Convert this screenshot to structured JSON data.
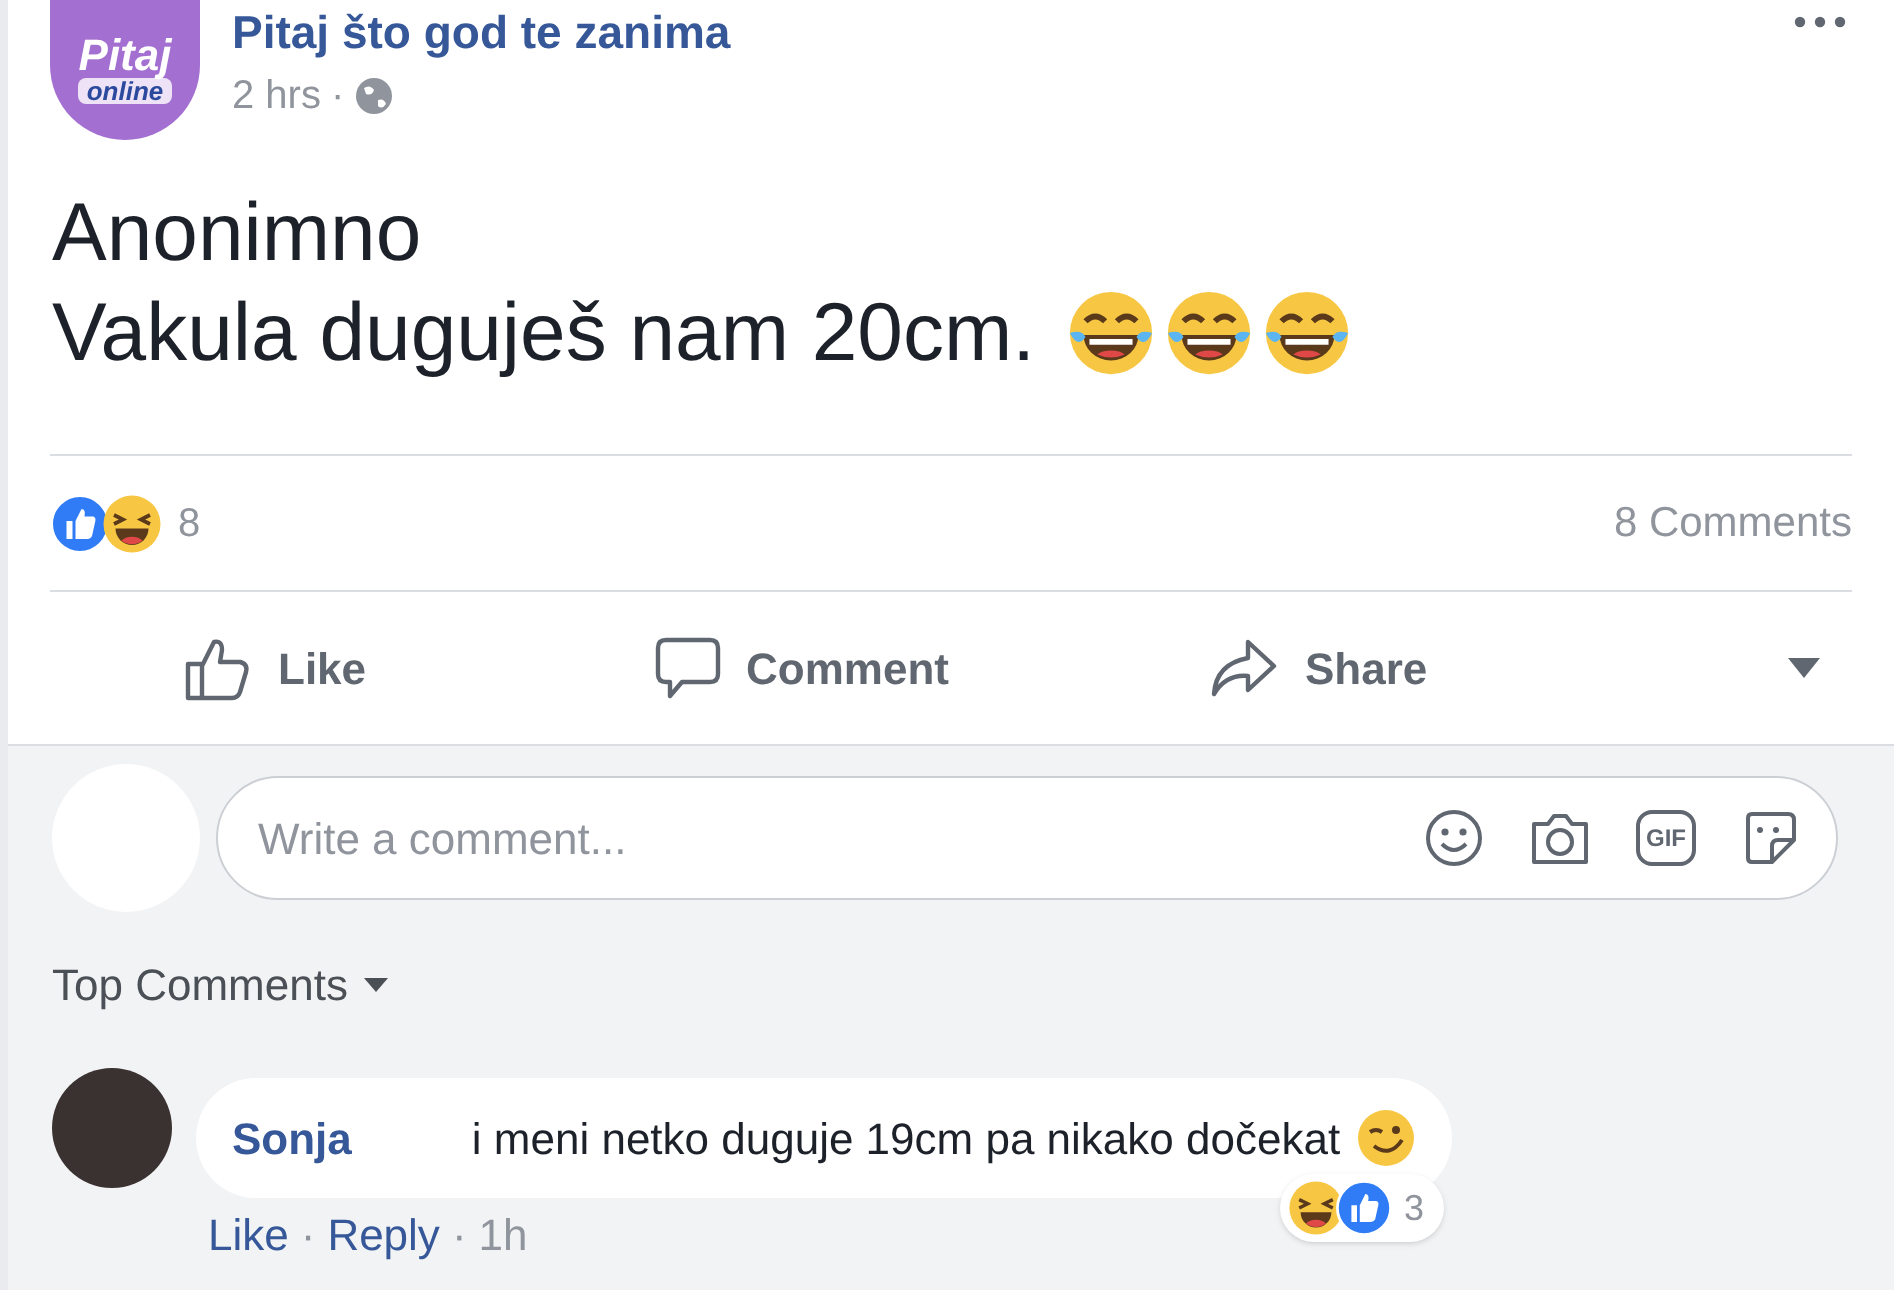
{
  "post": {
    "page_name": "Pitaj što god te zanima",
    "logo": {
      "line_1": "Pitaj",
      "line_2": "online"
    },
    "time": "2 hrs",
    "separator": "·",
    "lines": [
      "Anonimno",
      "Vakula duguješ nam 20cm."
    ],
    "emojis": [
      {
        "kind": "laughing_tears"
      },
      {
        "kind": "laughing_tears"
      },
      {
        "kind": "laughing_tears"
      }
    ]
  },
  "reactions": {
    "count": "8",
    "comments": "8 Comments"
  },
  "actions": [
    {
      "kind": "like",
      "label": "Like"
    },
    {
      "kind": "comment",
      "label": "Comment"
    },
    {
      "kind": "share",
      "label": "Share"
    }
  ],
  "comment_box": {
    "placeholder": "Write a comment...",
    "gif_label": "GIF"
  },
  "sort": {
    "label": "Top Comments"
  },
  "comments": [
    {
      "author": "Sonja",
      "text": "i meni netko duguje 19cm pa nikako dočekat",
      "links": [
        "Like",
        "Reply"
      ],
      "separator": "·",
      "time": "1h",
      "reaction_count": "3"
    }
  ]
}
